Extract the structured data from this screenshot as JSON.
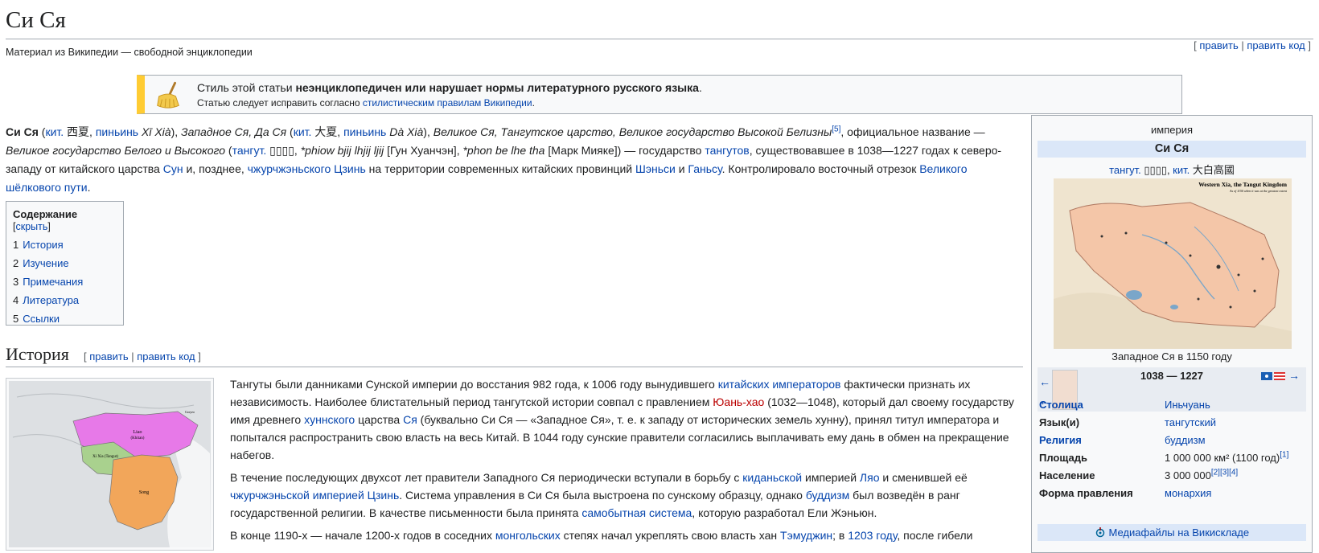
{
  "page": {
    "title": "Си Ся",
    "site_sub": "Материал из Википедии — свободной энциклопедии",
    "edit_links": {
      "open": "[ ",
      "edit": "править",
      "sep": " | ",
      "edit_code": "править код",
      "close": " ]"
    }
  },
  "ambox": {
    "line1_pre": "Стиль этой статьи ",
    "line1_bold": "неэнциклопедичен или нарушает нормы литературного русского языка",
    "line1_post": ".",
    "line2_pre": "Статью следует исправить согласно ",
    "line2_link": "стилистическим правилам Википедии",
    "line2_post": "."
  },
  "lead": {
    "t1": "Си Ся",
    "t2": " (",
    "l1": "кит.",
    "t3": " 西夏, ",
    "l2": "пиньинь",
    "t4": " Xī Xià",
    "t5": "), ",
    "t6": "Западное Ся, Да Ся",
    "t7": " (",
    "l3": "кит.",
    "t8": " 大夏, ",
    "l4": "пиньинь",
    "t9": " Dà Xià",
    "t10": "), ",
    "t11": "Великое Ся, Тангутское царство, Великое государство Высокой Белизны",
    "ref1": "[5]",
    "t12": ", официальное название — ",
    "t13": "Великое государство Белого и Высокого",
    "t14": " (",
    "l5": "тангут.",
    "t15": " ▯▯▯▯, ",
    "t16": "*phiow bjij lhjij ljij",
    "t17": " [Гун Хуанчэн], ",
    "t18": "*phon be lhe tha",
    "t19": " [Марк Мияке]) — государство ",
    "l6": "тангутов",
    "t20": ", существовавшее в 1038—1227 годах к северо-западу от китайского царства ",
    "l7": "Сун",
    "t21": " и, позднее, ",
    "l8": "чжурчжэньского Цзинь",
    "t22": " на территории современных китайских провинций ",
    "l9": "Шэньси",
    "t23": " и ",
    "l10": "Ганьсу",
    "t24": ". Контролировало восточный отрезок ",
    "l11": "Великого шёлкового пути",
    "t25": "."
  },
  "toc": {
    "title": "Содержание",
    "hide": "скрыть",
    "items": [
      {
        "num": "1",
        "label": "История"
      },
      {
        "num": "2",
        "label": "Изучение"
      },
      {
        "num": "3",
        "label": "Примечания"
      },
      {
        "num": "4",
        "label": "Литература"
      },
      {
        "num": "5",
        "label": "Ссылки"
      }
    ]
  },
  "history": {
    "heading": "История",
    "edit_open": "[ ",
    "edit": "править",
    "sep": " | ",
    "edit_code": "править код",
    "edit_close": " ]",
    "map_labels": {
      "liao": "Liao",
      "liao_sub": "(Khitan)",
      "xixia": "Xi Xia (Tangut)",
      "song": "Song",
      "goryeo": "Goryeo"
    },
    "p1": {
      "a": "Тангуты были данниками Сунской империи до восстания 982 года, к 1006 году вынудившего ",
      "l1": "китайских императоров",
      "b": " фактически признать их независимость. Наиболее блистательный период тангутской истории совпал с правлением ",
      "l2": "Юань-хао",
      "c": " (1032—1048), который дал своему государству имя древнего ",
      "l3": "хуннского",
      "d": " царства ",
      "l4": "Ся",
      "e": " (буквально Си Ся — «Западное Ся», т. е. к западу от исторических земель хунну), принял титул императора и попытался распространить свою власть на весь Китай. В 1044 году сунские правители согласились выплачивать ему дань в обмен на прекращение набегов."
    },
    "p2": {
      "a": "В течение последующих двухсот лет правители Западного Ся периодически вступали в борьбу с ",
      "l1": "киданьской",
      "b": " империей ",
      "l2": "Ляо",
      "c": " и сменившей её ",
      "l3": "чжурчжэньской империей Цзинь",
      "d": ". Система управления в Си Ся была выстроена по сунскому образцу, однако ",
      "l4": "буддизм",
      "e": " был возведён в ранг государственной религии. В качестве письменности была принята ",
      "l5": "самобытная система",
      "f": ", которую разработал Ели Жэньюн."
    },
    "p3": {
      "a": "В конце 1190-х — начале 1200-х годов в соседних ",
      "l1": "монгольских",
      "b": " степях начал укреплять свою власть хан ",
      "l2": "Тэмуджин",
      "c": "; в ",
      "l3": "1203 году",
      "d": ", после гибели"
    }
  },
  "infobox": {
    "kind": "империя",
    "name": "Си Ся",
    "native_l1": "тангут.",
    "native_t1": " ▯▯▯▯, ",
    "native_l2": "кит.",
    "native_t2": " 大白高國",
    "map_title": "Western Xia, the Tangut Kingdom",
    "map_sub": "As of 1150 when it was at the greatest extent",
    "caption": "Западное Ся в 1150 году",
    "years": "1038 — 1227",
    "arrow_left": "←",
    "arrow_right": "→",
    "rows": [
      {
        "label": "Столица",
        "value": "Иньчуань",
        "label_link": true,
        "value_link": true
      },
      {
        "label": "Язык(и)",
        "value": "тангутский",
        "label_link": false,
        "value_link": true
      },
      {
        "label": "Религия",
        "value": "буддизм",
        "label_link": true,
        "value_link": true
      },
      {
        "label": "Площадь",
        "value": "1 000 000 км² (1100 год)",
        "ref": "[1]",
        "label_link": false,
        "value_link": false
      },
      {
        "label": "Население",
        "value": "3 000 000",
        "ref": "[2][3][4]",
        "label_link": false,
        "value_link": false
      },
      {
        "label": "Форма правления",
        "value": "монархия",
        "label_link": false,
        "value_link": true
      }
    ],
    "media": "Медиафайлы на Викискладе"
  },
  "colors": {
    "link": "#0645ad",
    "redlink": "#ba0000",
    "ambox_bar": "#ffcc33",
    "infobox_header": "#dbe7f8"
  }
}
